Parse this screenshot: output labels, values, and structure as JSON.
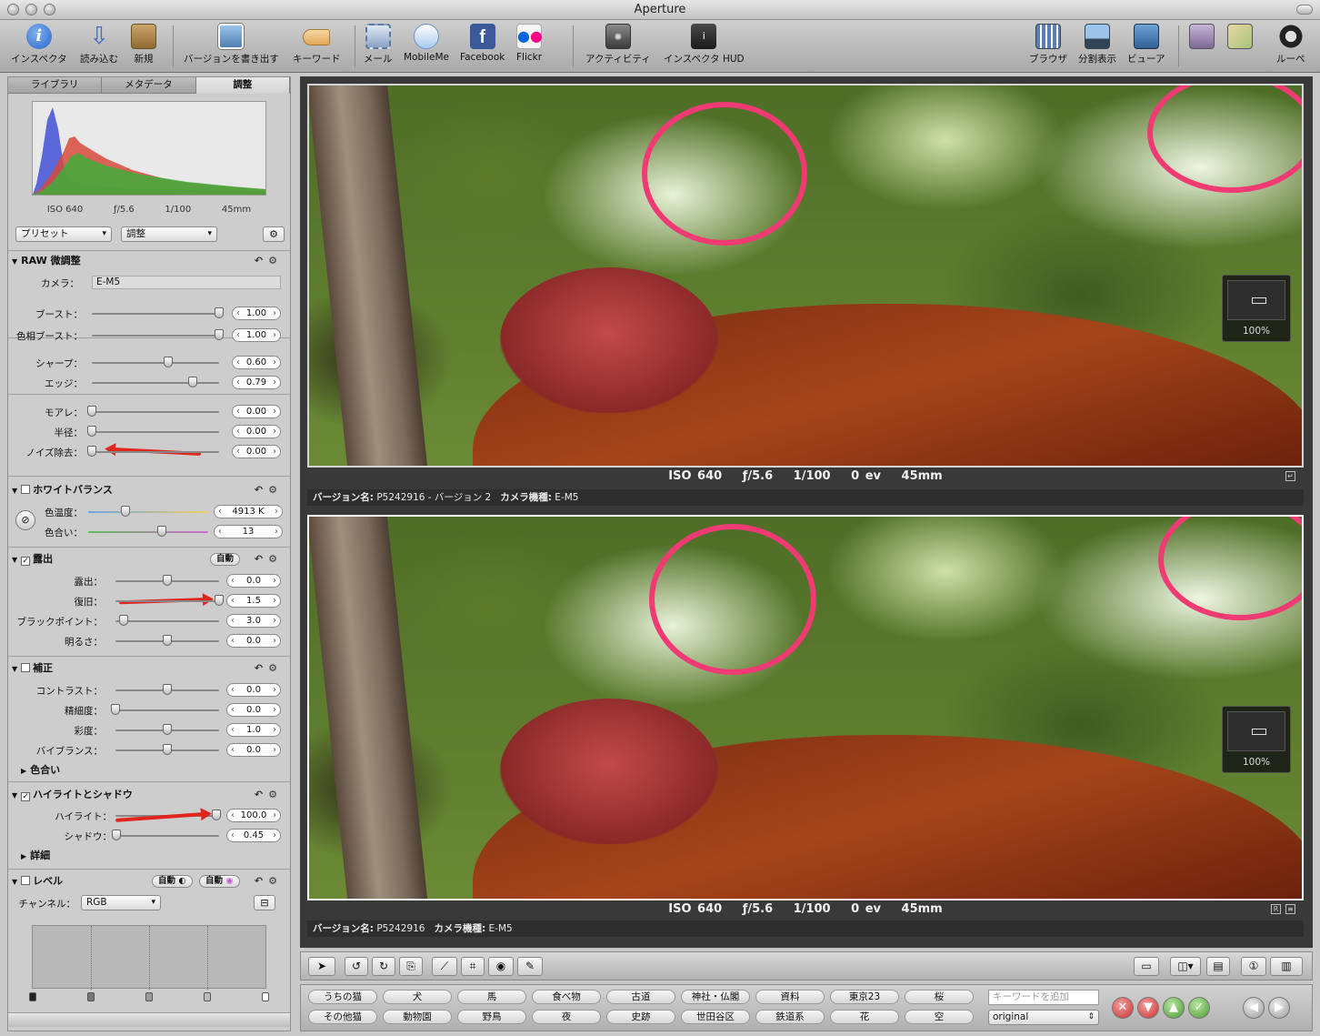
{
  "window": {
    "title": "Aperture"
  },
  "toolbar": {
    "inspector": "インスペクタ",
    "import": "読み込む",
    "new": "新規",
    "write_version": "バージョンを書き出す",
    "keyword": "キーワード",
    "mail": "メール",
    "mobileme": "MobileMe",
    "facebook": "Facebook",
    "flickr": "Flickr",
    "activity": "アクティビティ",
    "inspector_hud": "インスペクタ HUD",
    "browser": "ブラウザ",
    "split_view": "分割表示",
    "viewer": "ビューア",
    "loupe": "ルーペ"
  },
  "tabs": [
    "ライブラリ",
    "メタデータ",
    "調整"
  ],
  "histogram": {
    "iso": "ISO 640",
    "aperture": "ƒ/5.6",
    "shutter": "1/100",
    "focal": "45mm"
  },
  "presets": {
    "preset_label": "プリセット",
    "adjust_label": "調整"
  },
  "raw": {
    "title": "RAW 微調整",
    "camera_label": "カメラ：",
    "camera_value": "E-M5",
    "rows": [
      {
        "label": "ブースト：",
        "value": "1.00",
        "pos": 1.0
      },
      {
        "label": "色相ブースト：",
        "value": "1.00",
        "pos": 1.0
      },
      {
        "label": "シャープ：",
        "value": "0.60",
        "pos": 0.6
      },
      {
        "label": "エッジ：",
        "value": "0.79",
        "pos": 0.79
      },
      {
        "label": "モアレ：",
        "value": "0.00",
        "pos": 0.0
      },
      {
        "label": "半径：",
        "value": "0.00",
        "pos": 0.0
      },
      {
        "label": "ノイズ除去：",
        "value": "0.00",
        "pos": 0.0
      }
    ]
  },
  "white_balance": {
    "title": "ホワイトバランス",
    "temp_label": "色温度：",
    "temp_value": "4913 K",
    "tint_label": "色合い：",
    "tint_value": "13"
  },
  "exposure": {
    "title": "露出",
    "auto": "自動",
    "rows": [
      {
        "label": "露出：",
        "value": "0.0",
        "pos": 0.5
      },
      {
        "label": "復旧：",
        "value": "1.5",
        "pos": 1.0
      },
      {
        "label": "ブラックポイント：",
        "value": "3.0",
        "pos": 0.08
      },
      {
        "label": "明るさ：",
        "value": "0.0",
        "pos": 0.5
      }
    ]
  },
  "enhance": {
    "title": "補正",
    "rows": [
      {
        "label": "コントラスト：",
        "value": "0.0",
        "pos": 0.5
      },
      {
        "label": "精細度：",
        "value": "0.0",
        "pos": 0.0
      },
      {
        "label": "彩度：",
        "value": "1.0",
        "pos": 0.5
      },
      {
        "label": "バイブランス：",
        "value": "0.0",
        "pos": 0.5
      }
    ],
    "tint": "色合い"
  },
  "highlights": {
    "title": "ハイライトとシャドウ",
    "highlight_label": "ハイライト：",
    "highlight_value": "100.0",
    "shadow_label": "シャドウ：",
    "shadow_value": "0.45",
    "detail": "詳細"
  },
  "levels": {
    "title": "レベル",
    "auto1": "自動",
    "auto2": "自動",
    "channel_label": "チャンネル：",
    "channel_value": "RGB"
  },
  "viewer": {
    "top": {
      "iso": "ISO 640",
      "aperture": "ƒ/5.6",
      "shutter": "1/100",
      "ev": "0 ev",
      "focal": "45mm",
      "version_label": "バージョン名:",
      "version_value": "P5242916 - バージョン 2",
      "camera_label": "カメラ機種:",
      "camera_value": "E-M5",
      "zoom": "100%"
    },
    "bottom": {
      "iso": "ISO 640",
      "aperture": "ƒ/5.6",
      "shutter": "1/100",
      "ev": "0 ev",
      "focal": "45mm",
      "version_label": "バージョン名:",
      "version_value": "P5242916",
      "camera_label": "カメラ機種:",
      "camera_value": "E-M5",
      "zoom": "100%"
    }
  },
  "keywords": {
    "row1": [
      "うちの猫",
      "犬",
      "馬",
      "食べ物",
      "古道",
      "神社・仏閣",
      "資料",
      "東京23",
      "桜"
    ],
    "row2": [
      "その他猫",
      "動物園",
      "野鳥",
      "夜",
      "史跡",
      "世田谷区",
      "鉄道系",
      "花",
      "空"
    ],
    "add_placeholder": "キーワードを追加",
    "set_value": "original"
  },
  "colors": {
    "annotation_circle": "#ef3a74",
    "annotation_arrow": "#e0261c",
    "background": "#393939"
  }
}
